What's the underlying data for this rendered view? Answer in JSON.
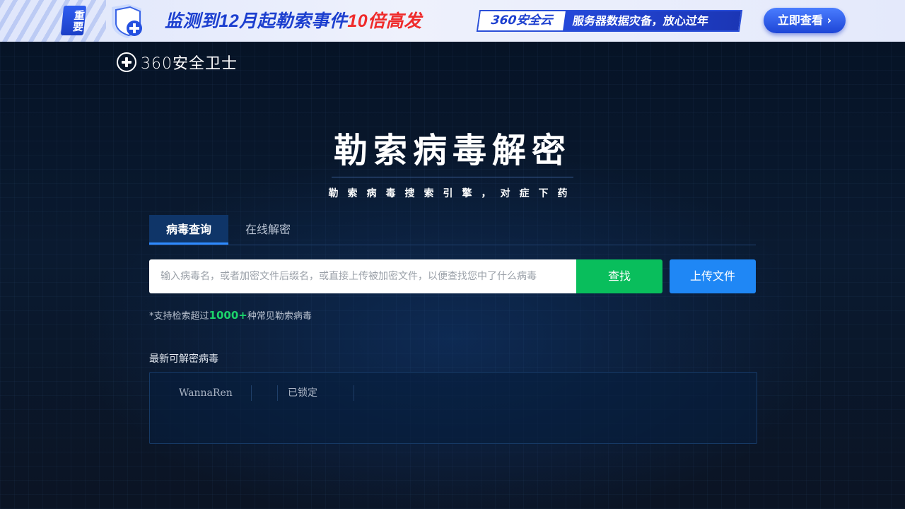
{
  "banner": {
    "badge": "重要",
    "headline_pre": "监测到12月起勒索事件",
    "headline_highlight": "10倍高发",
    "cloud_brand": "360安全云",
    "cloud_slogan": "服务器数据灾备，放心过年",
    "cta": "立即查看 ›"
  },
  "header": {
    "logo_text": "360安全卫士"
  },
  "hero": {
    "title": "勒索病毒解密",
    "subtitle": "勒索病毒搜索引擎，对症下药"
  },
  "tabs": [
    {
      "label": "病毒查询",
      "active": true
    },
    {
      "label": "在线解密",
      "active": false
    }
  ],
  "search": {
    "placeholder": "输入病毒名，或者加密文件后缀名，或直接上传被加密文件，以便查找您中了什么病毒",
    "value": "",
    "search_button": "查找",
    "upload_button": "上传文件"
  },
  "support_note": {
    "prefix": "*支持检索超过",
    "count": "1000+",
    "suffix": "种常见勒索病毒"
  },
  "latest": {
    "label": "最新可解密病毒",
    "items": [
      {
        "name": "WannaRen",
        "status": "已锁定"
      }
    ]
  },
  "colors": {
    "background": "#0b1424",
    "search_green": "#09be5c",
    "upload_blue": "#1f87f5",
    "count_green": "#1cd36b",
    "banner_blue": "#1c3fcf",
    "banner_red": "#ef2b2b"
  }
}
